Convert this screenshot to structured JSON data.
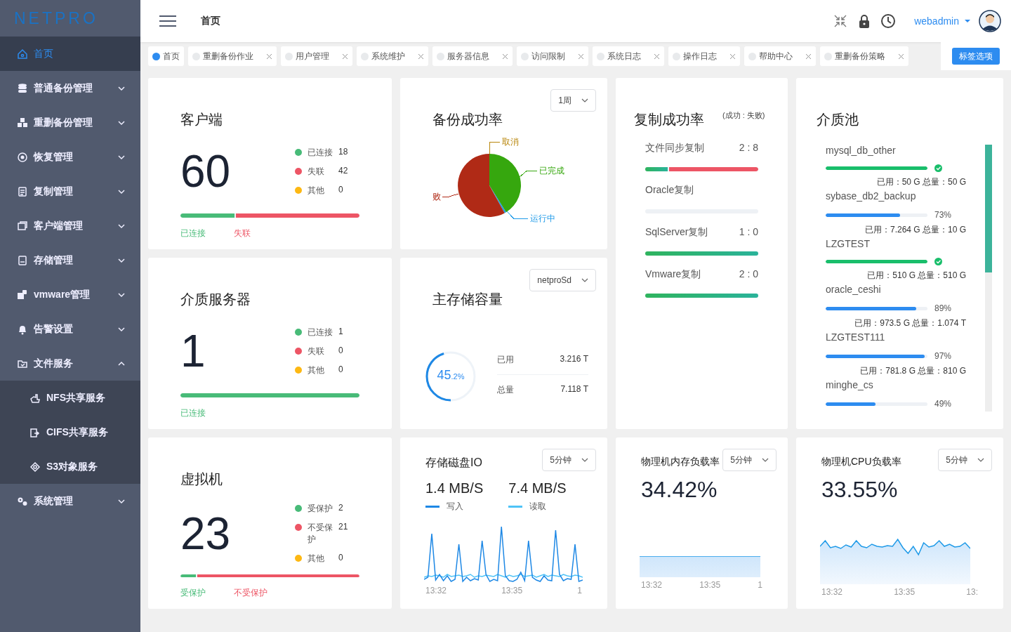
{
  "sidebar": {
    "logo": "NETPRO",
    "items": [
      {
        "label": "首页",
        "kind": "link",
        "selected": true
      },
      {
        "label": "普通备份管理",
        "kind": "group",
        "selected": false,
        "expanded": false
      },
      {
        "label": "重删备份管理",
        "kind": "group",
        "selected": false,
        "expanded": false
      },
      {
        "label": "恢复管理",
        "kind": "group",
        "selected": false,
        "expanded": false
      },
      {
        "label": "复制管理",
        "kind": "group",
        "selected": false,
        "expanded": false
      },
      {
        "label": "客户端管理",
        "kind": "group",
        "selected": false,
        "expanded": false
      },
      {
        "label": "存储管理",
        "kind": "group",
        "selected": false,
        "expanded": false
      },
      {
        "label": "vmware管理",
        "kind": "group",
        "selected": false,
        "expanded": false
      },
      {
        "label": "告警设置",
        "kind": "group",
        "selected": false,
        "expanded": false
      },
      {
        "label": "文件服务",
        "kind": "group",
        "selected": false,
        "expanded": true,
        "children": [
          {
            "label": "NFS共享服务",
            "selected": false
          },
          {
            "label": "CIFS共享服务",
            "selected": false
          },
          {
            "label": "S3对象服务",
            "selected": false
          }
        ]
      },
      {
        "label": "系统管理",
        "kind": "group",
        "selected": false,
        "expanded": false
      }
    ]
  },
  "header": {
    "breadcrumb": "首页",
    "user": "webadmin"
  },
  "tabs": [
    {
      "label": "首页",
      "selected": true,
      "closable": false
    },
    {
      "label": "重删备份作业",
      "selected": false,
      "closable": true
    },
    {
      "label": "用户管理",
      "selected": false,
      "closable": true
    },
    {
      "label": "系统维护",
      "selected": false,
      "closable": true
    },
    {
      "label": "服务器信息",
      "selected": false,
      "closable": true
    },
    {
      "label": "访问限制",
      "selected": false,
      "closable": true
    },
    {
      "label": "系统日志",
      "selected": false,
      "closable": true
    },
    {
      "label": "操作日志",
      "selected": false,
      "closable": true
    },
    {
      "label": "帮助中心",
      "selected": false,
      "closable": true
    },
    {
      "label": "重删备份策略",
      "selected": false,
      "closable": true
    }
  ],
  "tab_options_button": "标签选项",
  "clients": {
    "title": "客户端",
    "total": "60",
    "legend": [
      {
        "label": "已连接",
        "value": "18",
        "color": "#48bb78"
      },
      {
        "label": "失联",
        "value": "42",
        "color": "#ed5565"
      },
      {
        "label": "其他",
        "value": "0",
        "color": "#fdb813"
      }
    ],
    "bar": {
      "level": 0.3,
      "failed": true
    },
    "bar_labels": [
      {
        "label": "已连接"
      },
      {
        "label": "失联"
      }
    ]
  },
  "backup_success": {
    "title": "备份成功率",
    "period": "1周",
    "slices": [
      {
        "label": "取消",
        "color": "#b8860b"
      },
      {
        "label": "已完成",
        "color": "#36a70e"
      },
      {
        "label": "运行中",
        "color": "#1e9ae8"
      },
      {
        "label": "败",
        "color": "#b02a16"
      }
    ]
  },
  "replication": {
    "title": "复制成功率",
    "subtitle": "(成功 : 失败)",
    "rows": [
      {
        "label": "文件同步复制",
        "ratio": "2 : 8",
        "level": 0.2,
        "failed": true
      },
      {
        "label": "Oracle复制",
        "level": 0,
        "failed": false
      },
      {
        "label": "SqlServer复制",
        "ratio": "1 : 0",
        "level": 1,
        "failed": false
      },
      {
        "label": "Vmware复制",
        "ratio": "2 : 0",
        "level": 1,
        "failed": false
      }
    ]
  },
  "media_pool": {
    "title": "介质池",
    "items": [
      {
        "name": "mysql_db_other",
        "level": 1,
        "complete": true,
        "usage": "已用：50 G 总量：50 G"
      },
      {
        "name": "sybase_db2_backup",
        "level": 0.73,
        "complete": false,
        "percent": "73%",
        "usage": "已用：7.264 G 总量：10 G"
      },
      {
        "name": "LZGTEST",
        "level": 1,
        "complete": true,
        "usage": "已用：510 G 总量：510 G"
      },
      {
        "name": "oracle_ceshi",
        "level": 0.89,
        "complete": false,
        "percent": "89%",
        "usage": "已用：973.5 G 总量：1.074 T"
      },
      {
        "name": "LZGTEST111",
        "level": 0.97,
        "complete": false,
        "percent": "97%",
        "usage": "已用：781.8 G 总量：810 G"
      },
      {
        "name": "minghe_cs",
        "level": 0.49,
        "complete": false,
        "percent": "49%"
      }
    ]
  },
  "media_servers": {
    "title": "介质服务器",
    "total": "1",
    "legend": [
      {
        "label": "已连接",
        "value": "1",
        "color": "#48bb78"
      },
      {
        "label": "失联",
        "value": "0",
        "color": "#ed5565"
      },
      {
        "label": "其他",
        "value": "0",
        "color": "#fdb813"
      }
    ],
    "bar": {
      "level": 1,
      "failed": false
    },
    "bar_labels": [
      {
        "label": "已连接"
      }
    ]
  },
  "main_storage": {
    "title": "主存储容量",
    "pool": "netproSd",
    "level": 0.452,
    "percent_main": "45",
    "percent_fraction": ".2%",
    "rows": [
      {
        "label": "已用",
        "value": "3.216 T"
      },
      {
        "label": "总量",
        "value": "7.118 T"
      }
    ]
  },
  "vms": {
    "title": "虚拟机",
    "total": "23",
    "legend": [
      {
        "label": "受保护",
        "value": "2",
        "color": "#48bb78"
      },
      {
        "label": "不受保护",
        "value": "21",
        "color": "#ed5565"
      },
      {
        "label": "其他",
        "value": "0",
        "color": "#fdb813"
      }
    ],
    "bar": {
      "level": 0.087,
      "failed": true
    },
    "bar_labels": [
      {
        "label": "受保护"
      },
      {
        "label": "不受保护"
      }
    ]
  },
  "disk_io": {
    "title": "存储磁盘IO",
    "period": "5分钟",
    "series": [
      {
        "value": "1.4 MB/S",
        "label": "写入",
        "color": "#1e88e5"
      },
      {
        "value": "7.4 MB/S",
        "label": "读取",
        "color": "#4fc3f7"
      }
    ],
    "x_ticks": [
      "13:32",
      "13:35",
      "1"
    ]
  },
  "memory_load": {
    "title": "物理机内存负载率",
    "period": "5分钟",
    "value": "34.42%",
    "x_ticks": [
      "13:32",
      "13:35",
      "1"
    ]
  },
  "cpu_load": {
    "title": "物理机CPU负载率",
    "period": "5分钟",
    "value": "33.55%",
    "x_ticks": [
      "13:32",
      "13:35",
      "13:"
    ]
  }
}
